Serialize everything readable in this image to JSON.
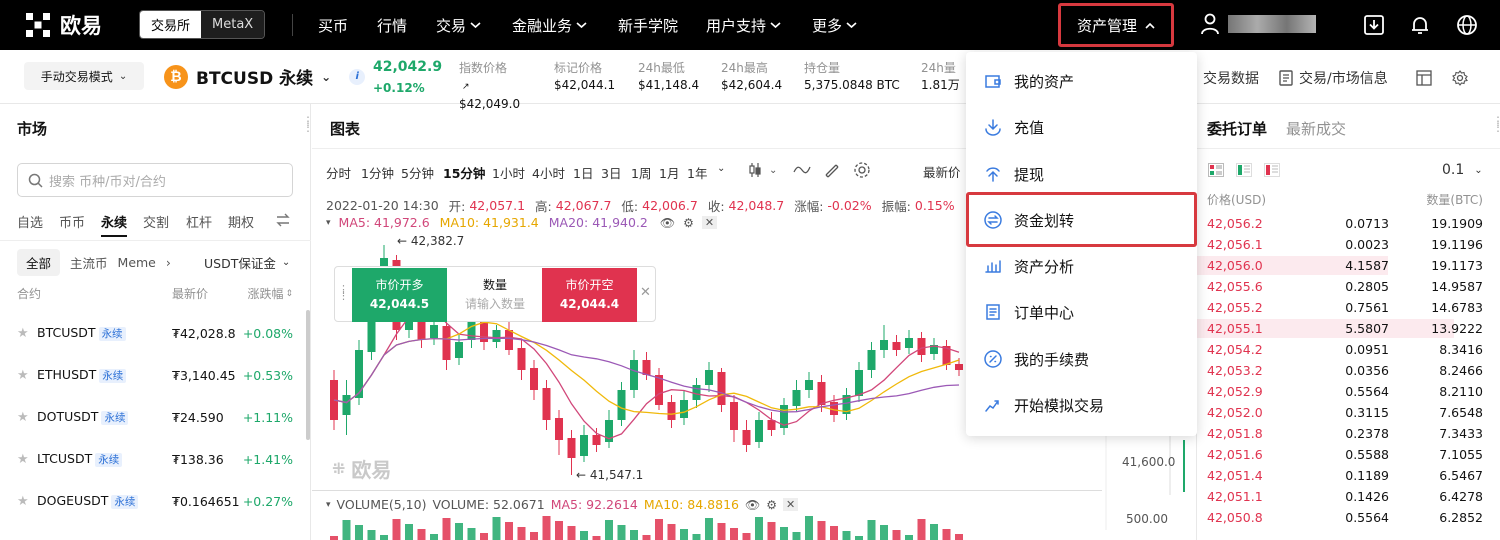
{
  "topnav": {
    "logo": "欧易",
    "seg": [
      "交易所",
      "MetaX"
    ],
    "items": [
      {
        "label": "买币",
        "chev": false
      },
      {
        "label": "行情",
        "chev": false
      },
      {
        "label": "交易",
        "chev": true
      },
      {
        "label": "金融业务",
        "chev": true
      },
      {
        "label": "新手学院",
        "chev": false
      },
      {
        "label": "用户支持",
        "chev": true
      },
      {
        "label": "更多",
        "chev": true
      }
    ],
    "asset_label": "资产管理"
  },
  "subbar": {
    "mode": "手动交易模式",
    "symbol": "BTCUSD 永续",
    "coin_glyph": "₿",
    "last_price": "42,042.9",
    "change": "+0.12%",
    "stats": [
      {
        "label": "指数价格",
        "value": "$42,049.0"
      },
      {
        "label": "标记价格",
        "value": "$42,044.1"
      },
      {
        "label": "24h最低",
        "value": "$41,148.4"
      },
      {
        "label": "24h最高",
        "value": "$42,604.4"
      },
      {
        "label": "持仓量",
        "value": "5,375.0848 BTC"
      },
      {
        "label": "24h量",
        "value": "1.81万"
      }
    ],
    "right_tools": [
      "交易数据",
      "交易/市场信息"
    ]
  },
  "market": {
    "title": "市场",
    "search_placeholder": "搜索 币种/币对/合约",
    "tabs": [
      "自选",
      "币币",
      "永续",
      "交割",
      "杠杆",
      "期权"
    ],
    "active_tab": "永续",
    "cats": [
      "全部",
      "主流币",
      "Meme"
    ],
    "margin": "USDT保证金",
    "headers": [
      "合约",
      "最新价",
      "涨跌幅"
    ],
    "rows": [
      {
        "name": "BTCUSDT",
        "badge": "永续",
        "price": "₮42,028.8",
        "chg": "+0.08%"
      },
      {
        "name": "ETHUSDT",
        "badge": "永续",
        "price": "₮3,140.45",
        "chg": "+0.53%"
      },
      {
        "name": "DOTUSDT",
        "badge": "永续",
        "price": "₮24.590",
        "chg": "+1.11%"
      },
      {
        "name": "LTCUSDT",
        "badge": "永续",
        "price": "₮138.36",
        "chg": "+1.41%"
      },
      {
        "name": "DOGEUSDT",
        "badge": "永续",
        "price": "₮0.164651",
        "chg": "+0.27%"
      }
    ]
  },
  "chart": {
    "title": "图表",
    "intervals": [
      "分时",
      "1分钟",
      "5分钟",
      "15分钟",
      "1小时",
      "4小时",
      "1日",
      "3日",
      "1周",
      "1月",
      "1年"
    ],
    "active_interval": "15分钟",
    "latest_label": "最新价",
    "ohlc": {
      "date": "2022-01-20 14:30",
      "open_label": "开:",
      "open": "42,057.1",
      "high_label": "高:",
      "high": "42,067.7",
      "low_label": "低:",
      "low": "42,006.7",
      "close_label": "收:",
      "close": "42,048.7",
      "chg_label": "涨幅:",
      "chg": "-0.02%",
      "amp_label": "振幅:",
      "amp": "0.15%"
    },
    "ma": {
      "ma5": "MA5: 41,972.6",
      "ma10": "MA10: 41,931.4",
      "ma20": "MA20: 41,940.2"
    },
    "high_label": "42,382.7",
    "low_label": "41,547.1",
    "axis_label": "41,600.0",
    "watermark": "欧易",
    "quick_trade": {
      "buy_label": "市价开多",
      "buy_price": "42,044.5",
      "qty_label": "数量",
      "qty_placeholder": "请输入数量",
      "sell_label": "市价开空",
      "sell_price": "42,044.4"
    },
    "volume": {
      "title": "VOLUME(5,10)",
      "vol": "VOLUME: 52.0671",
      "ma5": "MA5: 92.2614",
      "ma10": "MA10: 84.8816",
      "axis": "500.00"
    },
    "colors": {
      "up": "#1ea86a",
      "down": "#e0334f",
      "ma5": "#d1477a",
      "ma10": "#f0b90b",
      "ma20": "#9b59b6"
    }
  },
  "dropdown": {
    "items": [
      "我的资产",
      "充值",
      "提现",
      "资金划转",
      "资产分析",
      "订单中心",
      "我的手续费",
      "开始模拟交易"
    ],
    "highlighted": "资金划转"
  },
  "orderbook": {
    "tabs": [
      "委托订单",
      "最新成交"
    ],
    "precision": "0.1",
    "headers": [
      "价格(USD)",
      "数量(BTC)"
    ],
    "rows": [
      {
        "p": "42,056.2",
        "a": "0.0713",
        "t": "19.1909"
      },
      {
        "p": "42,056.1",
        "a": "0.0023",
        "t": "19.1196"
      },
      {
        "p": "42,056.0",
        "a": "4.1587",
        "t": "19.1173"
      },
      {
        "p": "42,055.6",
        "a": "0.2805",
        "t": "14.9587"
      },
      {
        "p": "42,055.2",
        "a": "0.7561",
        "t": "14.6783"
      },
      {
        "p": "42,055.1",
        "a": "5.5807",
        "t": "13.9222"
      },
      {
        "p": "42,054.2",
        "a": "0.0951",
        "t": "8.3416"
      },
      {
        "p": "42,053.2",
        "a": "0.0356",
        "t": "8.2466"
      },
      {
        "p": "42,052.9",
        "a": "0.5564",
        "t": "8.2110"
      },
      {
        "p": "42,052.0",
        "a": "0.3115",
        "t": "7.6548"
      },
      {
        "p": "42,051.8",
        "a": "0.2378",
        "t": "7.3433"
      },
      {
        "p": "42,051.6",
        "a": "0.5588",
        "t": "7.1055"
      },
      {
        "p": "42,051.4",
        "a": "0.1189",
        "t": "6.5467"
      },
      {
        "p": "42,051.1",
        "a": "0.1426",
        "t": "6.4278"
      },
      {
        "p": "42,050.8",
        "a": "0.5564",
        "t": "6.2852"
      }
    ]
  }
}
